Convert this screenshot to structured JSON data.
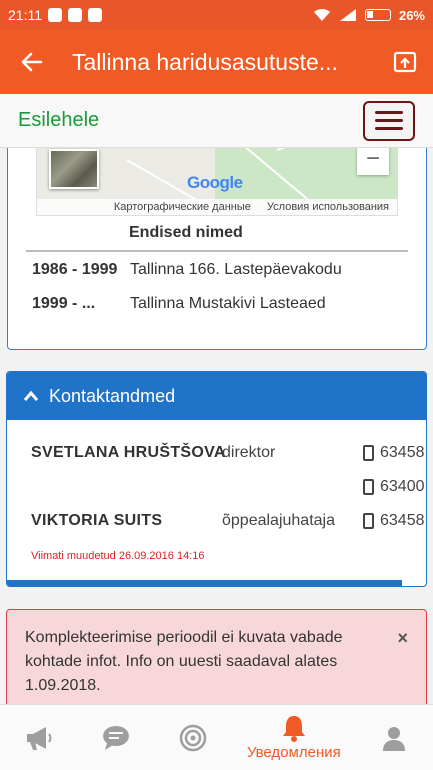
{
  "status": {
    "time": "21:11",
    "battery": "26%"
  },
  "appbar": {
    "title": "Tallinna haridusasutuste..."
  },
  "nav": {
    "home_link": "Esilehele"
  },
  "map": {
    "google_logo": "Google",
    "zoom_out": "−",
    "footer_data": "Картографические данные",
    "footer_terms": "Условия использования"
  },
  "former_names": {
    "header": "Endised nimed",
    "rows": [
      {
        "years": "1986 - 1999",
        "name": "Tallinna 166. Lastepäevakodu"
      },
      {
        "years": "1999 - ...",
        "name": "Tallinna Mustakivi Lasteaed"
      }
    ]
  },
  "contacts": {
    "header": "Kontaktandmed",
    "people": [
      {
        "name": "SVETLANA HRUŠTŠOVA",
        "role": "direktor",
        "phones": [
          "63458",
          "63400"
        ]
      },
      {
        "name": "VIKTORIA SUITS",
        "role": "õppealajuhataja",
        "phones": [
          "63458"
        ]
      }
    ],
    "modified": "Viimati muudetud 26.09.2016 14:16"
  },
  "alert": {
    "text": "Komplekteerimise perioodil ei kuvata vabade kohtade infot. Info on uuesti saadaval alates 1.09.2018.",
    "close": "×"
  },
  "bottom_nav": {
    "active_label": "Уведомления"
  },
  "colors": {
    "accent": "#f05a24",
    "primary_blue": "#1f73c8",
    "success_green": "#1a9a3a",
    "alert_bg": "#f8d7da"
  }
}
